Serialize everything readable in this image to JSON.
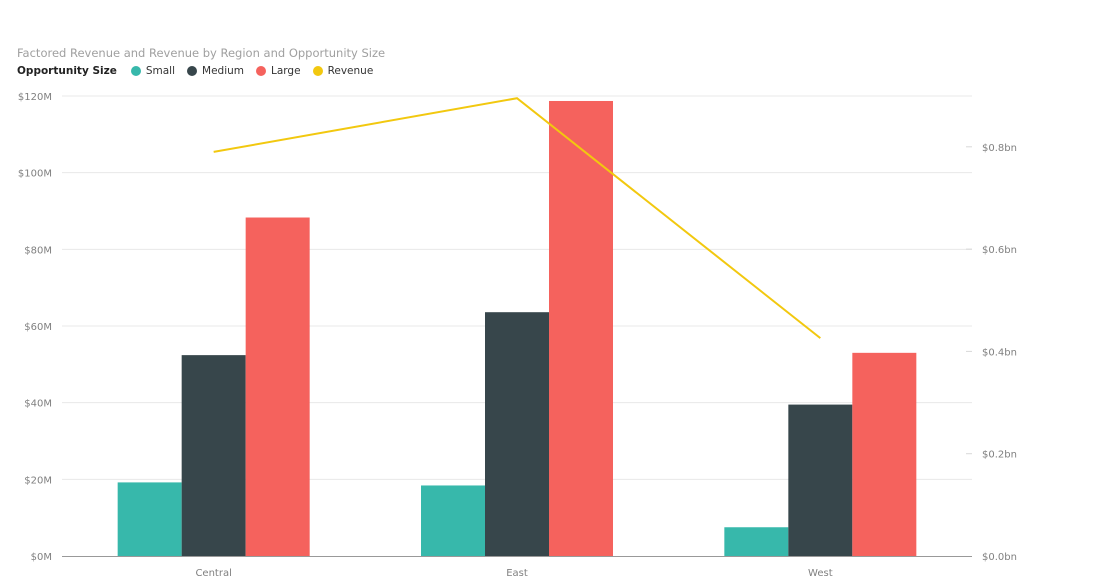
{
  "chart_data": {
    "type": "bar",
    "combo": "clustered-column-and-line",
    "title": "Factored Revenue and Revenue by Region and Opportunity Size",
    "legend": {
      "title": "Opportunity Size",
      "placement": "top-left",
      "items": [
        {
          "name": "Small",
          "color": "#37b8ab"
        },
        {
          "name": "Medium",
          "color": "#37464b"
        },
        {
          "name": "Large",
          "color": "#f5625d"
        },
        {
          "name": "Revenue",
          "color": "#f2c80f"
        }
      ]
    },
    "categories": [
      "Central",
      "East",
      "West"
    ],
    "series": [
      {
        "name": "Small",
        "type": "bar",
        "axis": "left",
        "color": "#37b8ab",
        "values": [
          19.2,
          18.4,
          7.5
        ]
      },
      {
        "name": "Medium",
        "type": "bar",
        "axis": "left",
        "color": "#37464b",
        "values": [
          52.4,
          63.6,
          39.5
        ]
      },
      {
        "name": "Large",
        "type": "bar",
        "axis": "left",
        "color": "#f5625d",
        "values": [
          88.3,
          118.7,
          53.0
        ]
      },
      {
        "name": "Revenue",
        "type": "line",
        "axis": "right",
        "color": "#f2c80f",
        "values": [
          0.79,
          0.895,
          0.426
        ]
      }
    ],
    "y_left": {
      "unit": "millions USD",
      "ylim": [
        0,
        120
      ],
      "ticks": [
        0,
        20,
        40,
        60,
        80,
        100,
        120
      ],
      "tick_labels": [
        "$0M",
        "$20M",
        "$40M",
        "$60M",
        "$80M",
        "$100M",
        "$120M"
      ]
    },
    "y_right": {
      "unit": "billions USD",
      "ylim": [
        0,
        0.9
      ],
      "ticks": [
        0,
        0.2,
        0.4,
        0.6,
        0.8
      ],
      "tick_labels": [
        "$0.0bn",
        "$0.2bn",
        "$0.4bn",
        "$0.6bn",
        "$0.8bn"
      ]
    },
    "xlabel": "",
    "ylabel": "",
    "grid": true
  }
}
